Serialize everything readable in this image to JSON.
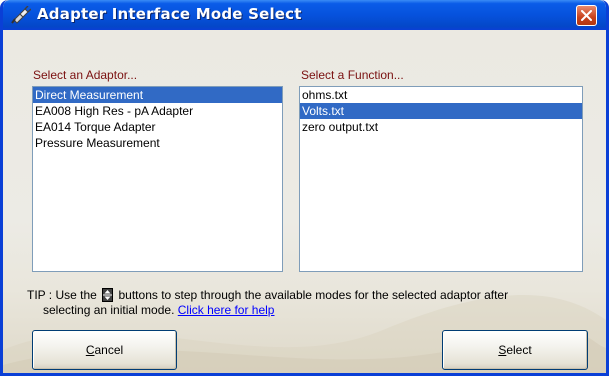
{
  "window": {
    "title": "Adapter Interface Mode Select",
    "colors": {
      "titlebar": "#0652dd",
      "selection": "#316ac5",
      "label": "#7a1010",
      "link": "#0000ff"
    }
  },
  "adaptors": {
    "label": "Select an Adaptor...",
    "items": [
      {
        "label": "Direct Measurement",
        "selected": true
      },
      {
        "label": "EA008 High Res - pA Adapter",
        "selected": false
      },
      {
        "label": "EA014 Torque Adapter",
        "selected": false
      },
      {
        "label": "Pressure Measurement",
        "selected": false
      }
    ]
  },
  "functions": {
    "label": "Select a Function...",
    "items": [
      {
        "label": "ohms.txt",
        "selected": false
      },
      {
        "label": "Volts.txt",
        "selected": true
      },
      {
        "label": "zero output.txt",
        "selected": false
      }
    ]
  },
  "tip": {
    "prefix": "TIP : Use the",
    "suffix": "buttons to step through the available modes for the selected adaptor after",
    "line2": "selecting an initial mode.",
    "link": "Click here for help",
    "icon": "spin-up-down-icon"
  },
  "buttons": {
    "cancel": {
      "accel": "C",
      "rest": "ancel"
    },
    "select": {
      "accel": "S",
      "rest": "elect"
    }
  }
}
